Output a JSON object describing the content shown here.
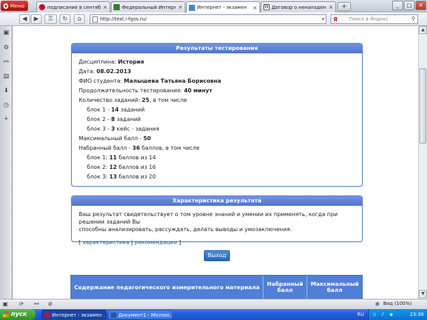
{
  "browser": {
    "menu_label": "Меню",
    "tabs": [
      {
        "label": "подписание в сентябре...",
        "icon": "opera-icon",
        "color": "#c8102e",
        "active": false
      },
      {
        "label": "Федеральный Интерне...",
        "icon": "grid-icon",
        "color": "#2f7d32",
        "active": false
      },
      {
        "label": "Интернет - экзамен",
        "icon": "page-icon",
        "color": "#4a86c5",
        "active": true
      },
      {
        "label": "Договор о ненападен...",
        "icon": "wikipedia-icon",
        "color": "#333333",
        "active": false
      }
    ],
    "url": "http://test.i-fgos.ru/",
    "search_placeholder": "Поиск в Яндекс",
    "search_engine_glyph": "Я",
    "zoom_label": "Вид (100%)"
  },
  "results_panel": {
    "title": "Результаты тестирования",
    "discipline_label": "Дисциплина:",
    "discipline_value": "История",
    "date_label": "Дата:",
    "date_value": "08.02.2013",
    "student_label": "ФИО студента:",
    "student_value": "Малышева Татьяна Борисовна",
    "duration_label": "Продолжительность тестирования:",
    "duration_value": "40 минут",
    "tasks_label": "Количество заданий:",
    "tasks_value": "25",
    "tasks_suffix": ", в том числе",
    "blocks": [
      {
        "prefix": "блок 1 - ",
        "value": "14",
        "suffix": " заданий"
      },
      {
        "prefix": "блок 2 - ",
        "value": "8",
        "suffix": " заданий"
      },
      {
        "prefix": "блок 3 - ",
        "value": "3",
        "suffix": " кейс - задания"
      }
    ],
    "max_score_label": "Максимальный балл - ",
    "max_score_value": "50",
    "earned_label": "Набранный балл - ",
    "earned_value": "36",
    "earned_suffix": " баллов, в том числе",
    "block_scores": [
      {
        "prefix": "блок 1: ",
        "value": "11",
        "suffix": " баллов из 14"
      },
      {
        "prefix": "блок 2: ",
        "value": "12",
        "suffix": " баллов из 16"
      },
      {
        "prefix": "блок 3: ",
        "value": "13",
        "suffix": " баллов из 20"
      }
    ]
  },
  "characteristic_panel": {
    "title": "Характеристика результата",
    "text_line1": "Ваш результат свидетельствует о том уровне знаний и умении их применять, когда при решении заданий Вы",
    "text_line2": "способны анализировать, рассуждать, делать выводы и умозаключения.",
    "bracket_open": "[ ",
    "link1": "характеристика",
    "separator": " | ",
    "link2": "рекомендации",
    "bracket_close": " ]"
  },
  "exit_button": "Выход",
  "content_table": {
    "headers": [
      "Содержание педагогического измерительного материала",
      "Набранный балл",
      "Максимальный балл"
    ]
  },
  "taskbar": {
    "start_label": "пуск",
    "items": [
      {
        "label": "Интернет - экзамен ...",
        "color": "#c8102e"
      },
      {
        "label": "Документ1 - Microso...",
        "color": "#2b579a"
      }
    ],
    "language": "RU",
    "clock": "23:38"
  },
  "accent_color": "#4f74cc"
}
